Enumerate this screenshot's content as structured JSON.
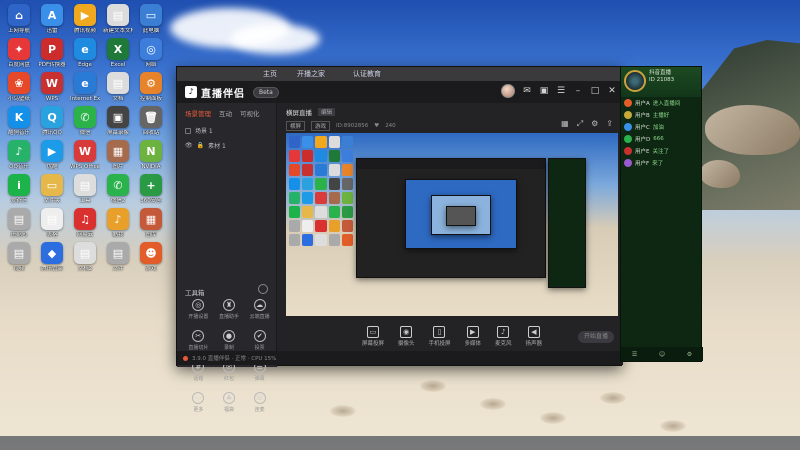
{
  "desktop_icons": [
    {
      "label": "上网导航",
      "color": "#2f64c8",
      "glyph": "⌂"
    },
    {
      "label": "迅雷",
      "color": "#3a8fe8",
      "glyph": "A"
    },
    {
      "label": "腾讯视频",
      "color": "#f0a81e",
      "glyph": "▶"
    },
    {
      "label": "新建文本文档",
      "color": "#dcdcdc",
      "glyph": "▤"
    },
    {
      "label": "此电脑",
      "color": "#3b7fd4",
      "glyph": "▭"
    },
    {
      "label": "百度网盘",
      "color": "#e63838",
      "glyph": "✦"
    },
    {
      "label": "PDF转换器",
      "color": "#cc2c2c",
      "glyph": "P"
    },
    {
      "label": "Edge",
      "color": "#1f8be0",
      "glyph": "e"
    },
    {
      "label": "Excel",
      "color": "#1f7a3a",
      "glyph": "X"
    },
    {
      "label": "网络",
      "color": "#3d7ddc",
      "glyph": "◎"
    },
    {
      "label": "小鸟壁纸",
      "color": "#e6492a",
      "glyph": "❀"
    },
    {
      "label": "WPS",
      "color": "#c93030",
      "glyph": "W"
    },
    {
      "label": "Internet Explorer",
      "color": "#2a7bd6",
      "glyph": "e"
    },
    {
      "label": "文档",
      "color": "#dcdcdc",
      "glyph": "▤"
    },
    {
      "label": "控制面板",
      "color": "#e7842b",
      "glyph": "⚙"
    },
    {
      "label": "酷狗音乐",
      "color": "#1590e8",
      "glyph": "K"
    },
    {
      "label": "腾讯QQ",
      "color": "#2aa2e0",
      "glyph": "Q"
    },
    {
      "label": "微信",
      "color": "#2bb34a",
      "glyph": "✆"
    },
    {
      "label": "屏幕录像",
      "color": "#444",
      "glyph": "▣"
    },
    {
      "label": "回收站",
      "color": "#666",
      "glyph": "🗑"
    },
    {
      "label": "QQ音乐",
      "color": "#27b26a",
      "glyph": "♪"
    },
    {
      "label": "优酷",
      "color": "#1c9be8",
      "glyph": "▶"
    },
    {
      "label": "WPS Office",
      "color": "#d93a3a",
      "glyph": "W"
    },
    {
      "label": "图片",
      "color": "#a66a4d",
      "glyph": "▦"
    },
    {
      "label": "NVIDIA",
      "color": "#6db33f",
      "glyph": "N"
    },
    {
      "label": "爱奇艺",
      "color": "#1cb34b",
      "glyph": "i"
    },
    {
      "label": "文件夹",
      "color": "#e6b84a",
      "glyph": "▭"
    },
    {
      "label": "工具",
      "color": "#ddd",
      "glyph": "▤"
    },
    {
      "label": "微信2",
      "color": "#2ab24d",
      "glyph": "✆"
    },
    {
      "label": "360安全",
      "color": "#2a9a45",
      "glyph": "+"
    },
    {
      "label": "压缩包",
      "color": "#aaa",
      "glyph": "▤"
    },
    {
      "label": "表格",
      "color": "#eee",
      "glyph": "▤"
    },
    {
      "label": "网易云",
      "color": "#d93030",
      "glyph": "♫"
    },
    {
      "label": "酷我",
      "color": "#e8a02b",
      "glyph": "♪"
    },
    {
      "label": "图库",
      "color": "#c55a3a",
      "glyph": "▦"
    },
    {
      "label": "视频",
      "color": "#aaa",
      "glyph": "▤"
    },
    {
      "label": "腾讯管家",
      "color": "#2c6de0",
      "glyph": "◆"
    },
    {
      "label": "文档2",
      "color": "#ddd",
      "glyph": "▤"
    },
    {
      "label": "文件",
      "color": "#aaa",
      "glyph": "▤"
    },
    {
      "label": "游戏",
      "color": "#e35d2a",
      "glyph": "☻"
    }
  ],
  "app": {
    "logo_text": "直播伴侣",
    "version_badge": "Beta",
    "bg_menu": [
      "主页",
      "开播之家",
      "认证教育"
    ],
    "left_tabs": [
      "场景管理",
      "互动",
      "可视化"
    ],
    "scenes": [
      "场景 1",
      "素材 1"
    ],
    "tools_title": "工具箱",
    "tools": [
      {
        "label": "开播设置",
        "glyph": "◎"
      },
      {
        "label": "直播助手",
        "glyph": "♜"
      },
      {
        "label": "云端直播",
        "glyph": "☁"
      },
      {
        "label": "直播切片",
        "glyph": "✂"
      },
      {
        "label": "录制",
        "glyph": "●"
      },
      {
        "label": "投票",
        "glyph": "✔"
      },
      {
        "label": "话题",
        "glyph": "#"
      },
      {
        "label": "红包",
        "glyph": "✉"
      },
      {
        "label": "弹幕",
        "glyph": "☰"
      },
      {
        "label": "更多",
        "glyph": "⋯"
      },
      {
        "label": "福袋",
        "glyph": "♣"
      },
      {
        "label": "连麦",
        "glyph": "☏"
      }
    ],
    "live_title": "横屏直播",
    "live_edit": "编辑",
    "live_tags": [
      "横屏",
      "游戏"
    ],
    "live_id": "ID:8902856",
    "live_views": "240",
    "bottom_buttons": [
      {
        "label": "屏幕投屏",
        "glyph": "▭"
      },
      {
        "label": "摄像头",
        "glyph": "◉"
      },
      {
        "label": "手机投屏",
        "glyph": "▯"
      },
      {
        "label": "多媒体",
        "glyph": "▶"
      },
      {
        "label": "麦克风",
        "glyph": "♪"
      },
      {
        "label": "扬声器",
        "glyph": "◀"
      }
    ],
    "start_button": "开始直播",
    "status_text": "3.9.0  直播伴侣 · 正常 · CPU 15%"
  },
  "chat": {
    "room_title": "抖音直播",
    "room_sub": "ID 21083",
    "lines": [
      {
        "name": "用户A",
        "msg": "进入直播间",
        "color": "#e35d2a"
      },
      {
        "name": "用户B",
        "msg": "主播好",
        "color": "#c8a83a"
      },
      {
        "name": "用户C",
        "msg": "加油",
        "color": "#3a8fe8"
      },
      {
        "name": "用户D",
        "msg": "666",
        "color": "#2ab24d"
      },
      {
        "name": "用户E",
        "msg": "关注了",
        "color": "#c93030"
      },
      {
        "name": "用户F",
        "msg": "来了",
        "color": "#9a5ad0"
      }
    ],
    "footer": [
      "☰",
      "☺",
      "⚙"
    ]
  }
}
